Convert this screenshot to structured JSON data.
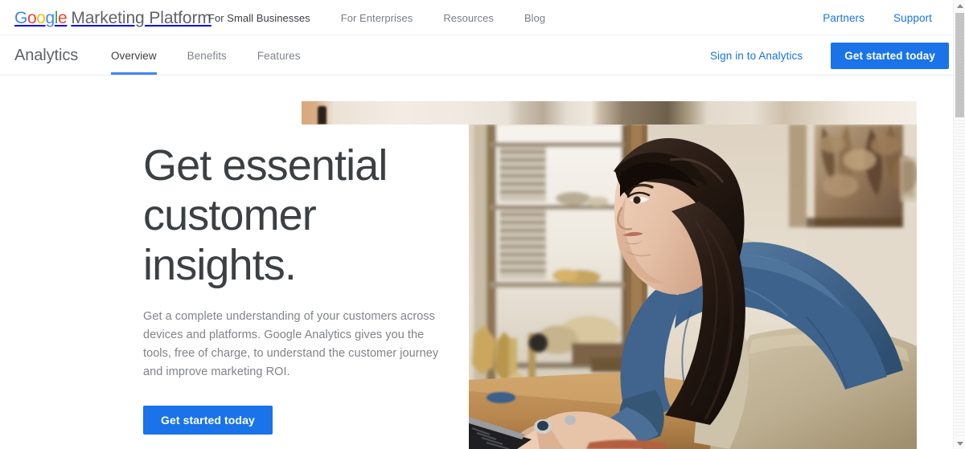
{
  "topnav": {
    "brand_logo_letters": [
      {
        "char": "G",
        "color": "#4285f4"
      },
      {
        "char": "o",
        "color": "#ea4335"
      },
      {
        "char": "o",
        "color": "#fbbc05"
      },
      {
        "char": "g",
        "color": "#4285f4"
      },
      {
        "char": "l",
        "color": "#34a853"
      },
      {
        "char": "e",
        "color": "#ea4335"
      }
    ],
    "brand_logo_text": "Google",
    "brand_suffix": "Marketing Platform",
    "links": [
      {
        "label": "For Small Businesses",
        "active": true
      },
      {
        "label": "For Enterprises",
        "active": false
      },
      {
        "label": "Resources",
        "active": false
      },
      {
        "label": "Blog",
        "active": false
      }
    ],
    "right_links": [
      {
        "label": "Partners"
      },
      {
        "label": "Support"
      }
    ]
  },
  "productnav": {
    "title": "Analytics",
    "tabs": [
      {
        "label": "Overview",
        "active": true
      },
      {
        "label": "Benefits",
        "active": false
      },
      {
        "label": "Features",
        "active": false
      }
    ],
    "signin_label": "Sign in to Analytics",
    "cta_label": "Get started today"
  },
  "hero": {
    "title": "Get essential\ncustomer\ninsights.",
    "subtitle": "Get a complete understanding of your customers across devices and platforms. Google Analytics gives you the tools, free of charge, to understand the customer journey and improve marketing ROI.",
    "cta_label": "Get started today",
    "image_alt": "Woman in denim shirt and apron typing on a laptop in a shop"
  },
  "scrollbar": {
    "up_arrow_icon": "triangle-up-icon",
    "down_arrow_icon": "triangle-down-icon",
    "thumb_label": "vertical-scroll-thumb"
  },
  "colors": {
    "brand_blue": "#1a73e8",
    "tab_underline": "#4285f4",
    "heading": "#3c4043",
    "body_text": "#808488",
    "muted_nav": "#7a7f84"
  }
}
